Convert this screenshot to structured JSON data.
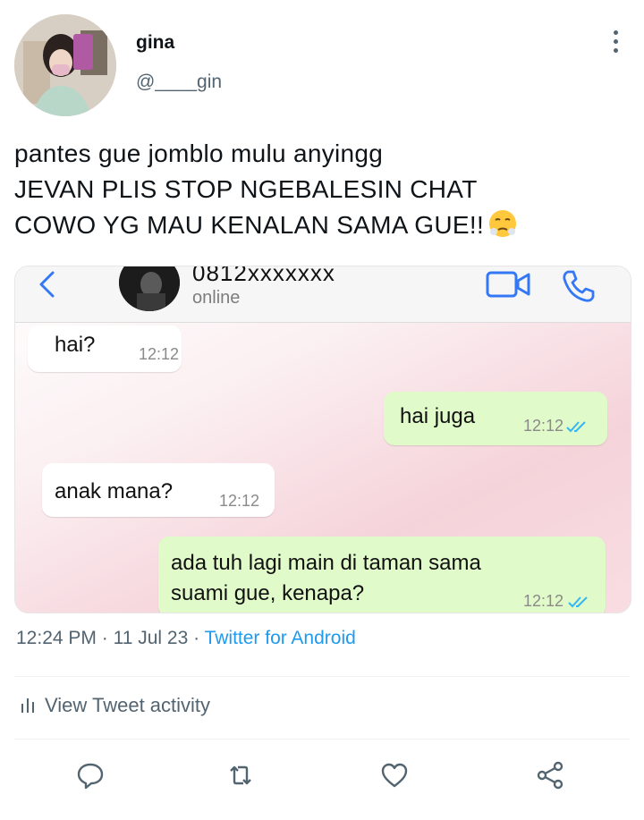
{
  "tweet": {
    "display_name": "gina",
    "handle": "@____gin",
    "text_lines": [
      "pantes gue jomblo mulu anyingg",
      "JEVAN PLIS STOP NGEBALESIN CHAT",
      "COWO YG MAU KENALAN SAMA GUE!!"
    ],
    "emoji": "face-with-steam-from-nose",
    "time": "12:24 PM",
    "date": "11 Jul 23",
    "source": "Twitter for Android",
    "separator": "·",
    "activity_label": "View Tweet activity"
  },
  "chat_screenshot": {
    "contact_name": "0812xxxxxxx",
    "contact_status": "online",
    "messages": [
      {
        "direction": "in",
        "text": "hai?",
        "time": "12:12"
      },
      {
        "direction": "out",
        "text": "hai juga",
        "time": "12:12",
        "read": true
      },
      {
        "direction": "in",
        "text": "anak mana?",
        "time": "12:12"
      },
      {
        "direction": "out",
        "text_lines": [
          "ada tuh lagi main di taman sama",
          "suami gue, kenapa?"
        ],
        "time": "12:12",
        "read": true
      }
    ]
  },
  "actions": [
    "reply-icon",
    "retweet-icon",
    "like-icon",
    "share-icon"
  ],
  "colors": {
    "link": "#1d9bf0",
    "muted": "#536471",
    "incoming_bubble": "#ffffff",
    "outgoing_bubble": "#e1fac9",
    "tick": "#34b7f1",
    "chat_accent": "#3478f6"
  }
}
